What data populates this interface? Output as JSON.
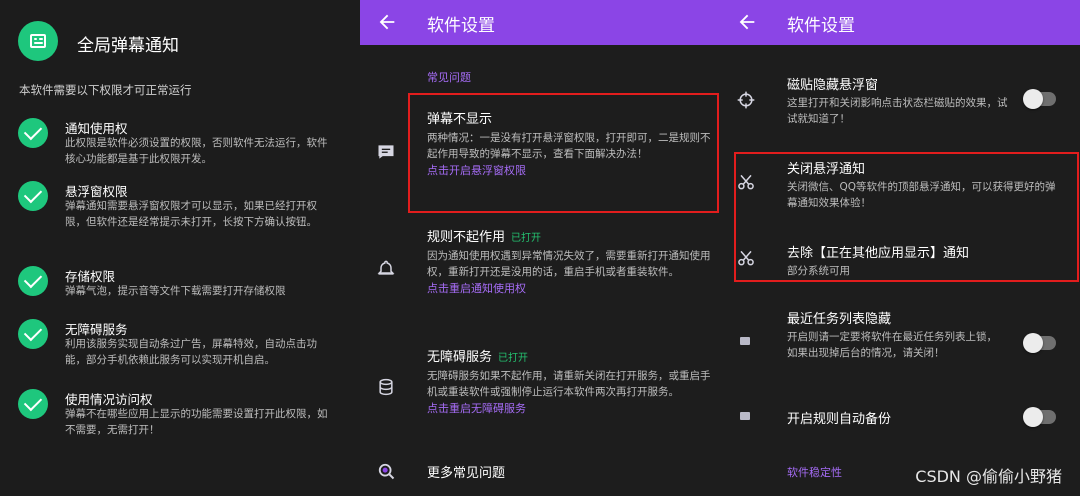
{
  "panel1": {
    "app_title": "全局弹幕通知",
    "intro": "本软件需要以下权限才可正常运行",
    "permissions": [
      {
        "title": "通知使用权",
        "desc": "此权限是软件必须设置的权限，否则软件无法运行，软件核心功能都是基于此权限开发。"
      },
      {
        "title": "悬浮窗权限",
        "desc": "弹幕通知需要悬浮窗权限才可以显示，如果已经打开权限，但软件还是经常提示未打开，长按下方确认按钮。"
      },
      {
        "title": "存储权限",
        "desc": "弹幕气泡，提示音等文件下载需要打开存储权限"
      },
      {
        "title": "无障碍服务",
        "desc": "利用该服务实现自动条过广告，屏幕特效，自动点击功能，部分手机依赖此服务可以实现开机自启。"
      },
      {
        "title": "使用情况访问权",
        "desc": "弹幕不在哪些应用上显示的功能需要设置打开此权限，如不需要，无需打开！"
      }
    ]
  },
  "panel2": {
    "toolbar_title": "软件设置",
    "section": "常见问题",
    "items": [
      {
        "title": "弹幕不显示",
        "badge": "",
        "desc": "两种情况：一是没有打开悬浮窗权限，打开即可，二是规则不起作用导致的弹幕不显示，查看下面解决办法！",
        "link": "点击开启悬浮窗权限"
      },
      {
        "title": "规则不起作用",
        "badge": "已打开",
        "desc": "因为通知使用权遇到异常情况失效了，需要重新打开通知使用权，重新打开还是没用的话，重启手机或者重装软件。",
        "link": "点击重启通知使用权"
      },
      {
        "title": "无障碍服务",
        "badge": "已打开",
        "desc": "无障碍服务如果不起作用，请重新关闭在打开服务，或重启手机或重装软件或强制停止运行本软件两次再打开服务。",
        "link": "点击重启无障碍服务"
      },
      {
        "title": "更多常见问题",
        "badge": "",
        "desc": "",
        "link": ""
      }
    ]
  },
  "panel3": {
    "toolbar_title": "软件设置",
    "items": [
      {
        "title": "磁贴隐藏悬浮窗",
        "desc": "这里打开和关闭影响点击状态栏磁贴的效果，试试就知道了！",
        "toggle_on": false
      },
      {
        "title": "关闭悬浮通知",
        "desc": "关闭微信、QQ等软件的顶部悬浮通知，可以获得更好的弹幕通知效果体验！"
      },
      {
        "title": "去除【正在其他应用显示】通知",
        "desc": "部分系统可用"
      },
      {
        "title": "最近任务列表隐藏",
        "desc": "开启则请一定要将软件在最近任务列表上锁，如果出现掉后台的情况，请关闭！",
        "toggle_on": false
      },
      {
        "title": "开启规则自动备份",
        "desc": "",
        "toggle_on": false
      }
    ],
    "section_bottom": "软件稳定性"
  },
  "watermark": "CSDN @偷偷小野猪",
  "colors": {
    "accent": "#8b45e6",
    "link": "#a56cf5",
    "check_green": "#1ec77d",
    "badge_green": "#24c06f",
    "highlight_red": "#e21d1d"
  }
}
